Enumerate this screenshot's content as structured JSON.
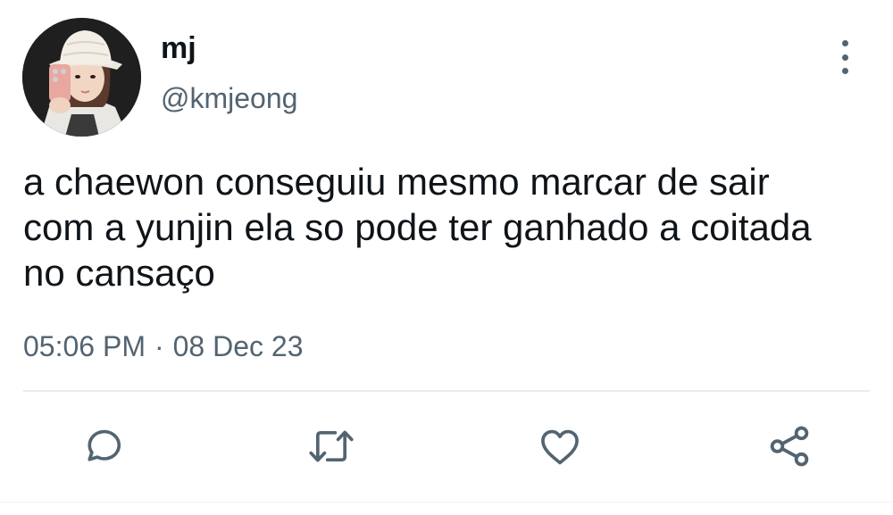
{
  "user": {
    "display_name": "mj",
    "handle": "@kmjeong",
    "avatar": "avatar-photo"
  },
  "tweet": {
    "text": "a chaewon conseguiu mesmo marcar de sair\ncom a yunjin ela so pode ter ganhado a coitada\nno cansaço",
    "time": "05:06 PM",
    "separator": "·",
    "date": "08 Dec 23"
  },
  "icons": {
    "more": "more-vertical-icon",
    "reply": "reply-icon",
    "retweet": "retweet-icon",
    "like": "heart-icon",
    "share": "share-icon"
  },
  "colors": {
    "text_primary": "#0f1419",
    "text_secondary": "#536471",
    "divider": "#e6ecf0"
  }
}
